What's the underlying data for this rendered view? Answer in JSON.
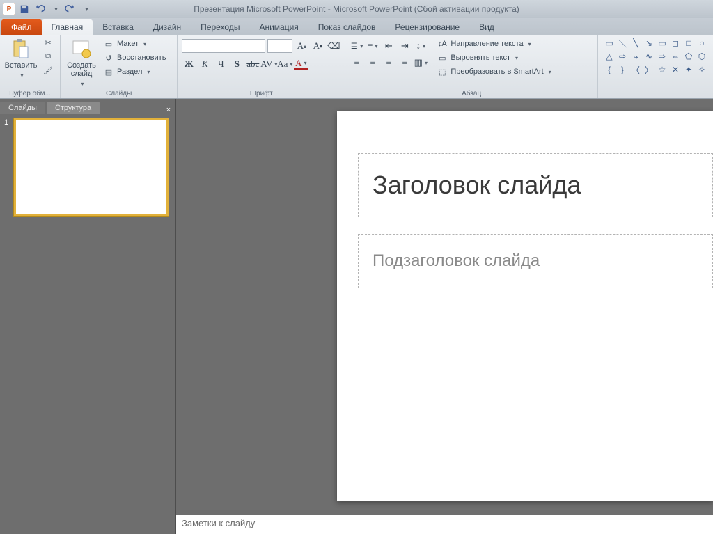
{
  "titlebar": {
    "title": "Презентация Microsoft PowerPoint  -  Microsoft PowerPoint (Сбой активации продукта)"
  },
  "qat": {
    "app_label": "P"
  },
  "tabs": {
    "file": "Файл",
    "items": [
      "Главная",
      "Вставка",
      "Дизайн",
      "Переходы",
      "Анимация",
      "Показ слайдов",
      "Рецензирование",
      "Вид"
    ],
    "active_index": 0
  },
  "ribbon": {
    "clipboard": {
      "paste": "Вставить",
      "label": "Буфер обм..."
    },
    "slides": {
      "new_slide": "Создать\nслайд",
      "layout": "Макет",
      "reset": "Восстановить",
      "section": "Раздел",
      "label": "Слайды"
    },
    "font": {
      "label": "Шрифт"
    },
    "paragraph": {
      "text_direction": "Направление текста",
      "align_text": "Выровнять текст",
      "smartart": "Преобразовать в SmartArt",
      "label": "Абзац"
    }
  },
  "sidepane": {
    "tabs": [
      "Слайды",
      "Структура"
    ],
    "active_index": 0,
    "thumb_number": "1"
  },
  "slide": {
    "title_placeholder": "Заголовок слайда",
    "subtitle_placeholder": "Подзаголовок слайда"
  },
  "notes": {
    "placeholder": "Заметки к слайду"
  }
}
